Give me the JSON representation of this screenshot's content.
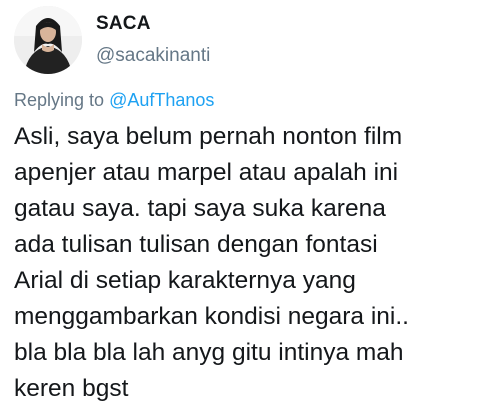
{
  "tweet": {
    "author": {
      "display_name": "SACA",
      "handle": "@sacakinanti",
      "avatar_icon": "profile-photo"
    },
    "reply": {
      "prefix": "Replying to ",
      "mention": "@AufThanos"
    },
    "text": "Asli, saya belum pernah nonton film\napenjer atau marpel atau apalah ini\ngatau saya. tapi saya suka karena\nada tulisan tulisan dengan fontasi\nArial di setiap karakternya yang\nmenggambarkan kondisi negara ini..\nbla bla bla lah anyg gitu intinya mah\nkeren bgst"
  },
  "colors": {
    "text_primary": "#14171a",
    "text_secondary": "#657786",
    "link_blue": "#1da1f2",
    "background": "#ffffff"
  }
}
